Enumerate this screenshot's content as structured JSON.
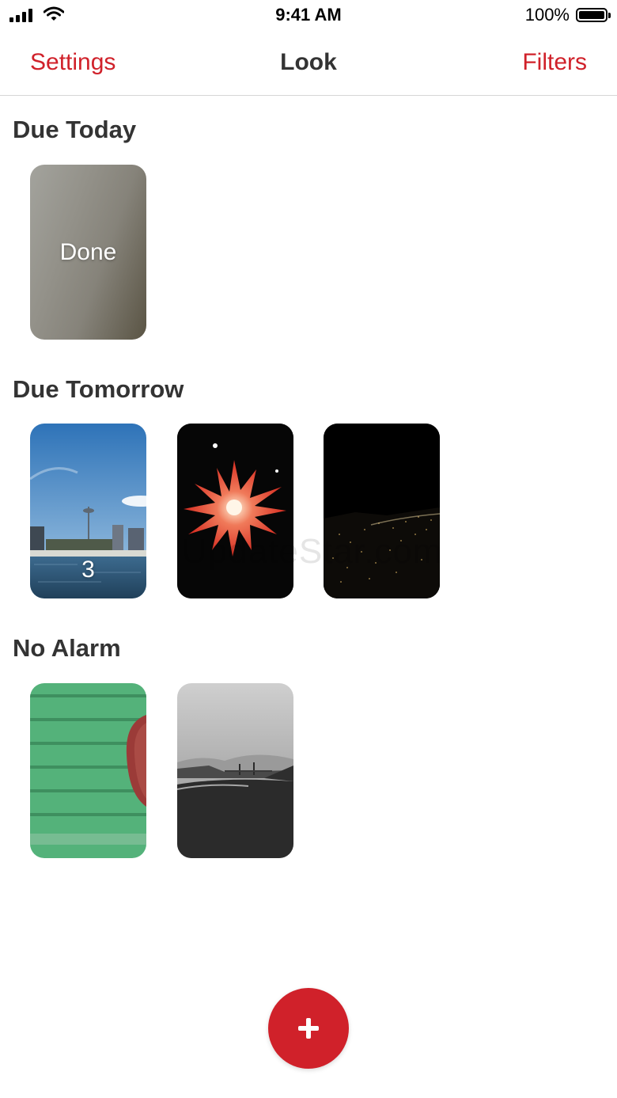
{
  "status_bar": {
    "time": "9:41 AM",
    "battery": "100%",
    "icons": [
      "signal-icon",
      "wifi-icon",
      "battery-icon"
    ]
  },
  "nav": {
    "left": "Settings",
    "title": "Look",
    "right": "Filters"
  },
  "sections": {
    "due_today": {
      "title": "Due Today",
      "cards": [
        {
          "label": "Done"
        }
      ]
    },
    "due_tomorrow": {
      "title": "Due Tomorrow",
      "cards": [
        {
          "label": "3"
        },
        {
          "label": ""
        },
        {
          "label": ""
        }
      ]
    },
    "no_alarm": {
      "title": "No Alarm",
      "cards": [
        {
          "label": ""
        },
        {
          "label": ""
        }
      ]
    }
  },
  "watermark": "UpdateStar.com",
  "colors": {
    "accent": "#d0212a",
    "text": "#333333",
    "divider": "#d6d6d6"
  },
  "fab": {
    "icon": "plus-icon"
  }
}
